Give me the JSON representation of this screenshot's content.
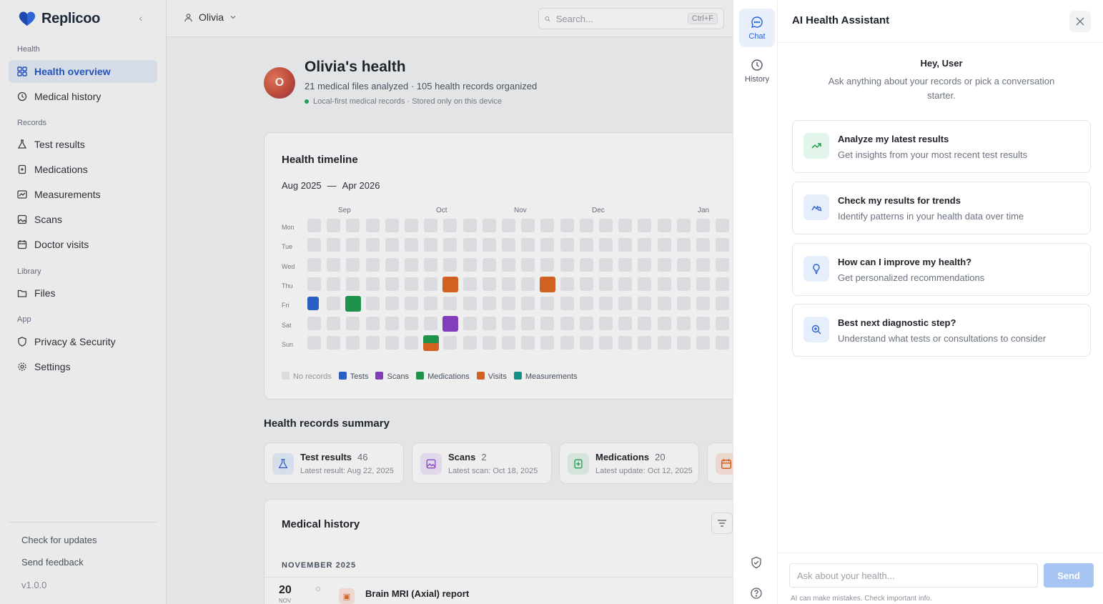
{
  "app": {
    "name": "Replicoo"
  },
  "sidebar": {
    "sections": [
      {
        "label": "Health",
        "items": [
          {
            "label": "Health overview",
            "icon": "grid-icon",
            "active": true
          },
          {
            "label": "Medical history",
            "icon": "clock-icon"
          }
        ]
      },
      {
        "label": "Records",
        "items": [
          {
            "label": "Test results",
            "icon": "flask-icon"
          },
          {
            "label": "Medications",
            "icon": "pill-box-icon"
          },
          {
            "label": "Measurements",
            "icon": "chart-icon"
          },
          {
            "label": "Scans",
            "icon": "image-icon"
          },
          {
            "label": "Doctor visits",
            "icon": "calendar-icon"
          }
        ]
      },
      {
        "label": "Library",
        "items": [
          {
            "label": "Files",
            "icon": "folder-icon"
          }
        ]
      },
      {
        "label": "App",
        "items": [
          {
            "label": "Privacy & Security",
            "icon": "shield-icon"
          },
          {
            "label": "Settings",
            "icon": "gear-icon"
          }
        ]
      }
    ],
    "footer": {
      "check_updates": "Check for updates",
      "send_feedback": "Send feedback",
      "version": "v1.0.0"
    }
  },
  "topbar": {
    "user": "Olivia",
    "search_placeholder": "Search...",
    "shortcut": "Ctrl+F"
  },
  "profile": {
    "initial": "O",
    "title": "Olivia's health",
    "subtitle": "21 medical files analyzed · 105 health records organized",
    "local_note": "Local-first medical records · Stored only on this device"
  },
  "timeline": {
    "title": "Health timeline",
    "range_start": "Aug 2025",
    "range_sep": "—",
    "range_end": "Apr 2026",
    "months": [
      "Sep",
      "Oct",
      "Nov",
      "Dec",
      "Jan"
    ],
    "days": [
      "Mon",
      "Tue",
      "Wed",
      "Thu",
      "Fri",
      "Sat",
      "Sun"
    ],
    "marks": [
      {
        "week": 0,
        "day": 4,
        "type": "Tests"
      },
      {
        "week": 2,
        "day": 4,
        "type": "Medications"
      },
      {
        "week": 7,
        "day": 3,
        "type": "Visits"
      },
      {
        "week": 7,
        "day": 5,
        "type": "Scans"
      },
      {
        "week": 6,
        "day": 6,
        "type": "Medications+Visits"
      },
      {
        "week": 12,
        "day": 3,
        "type": "Visits"
      }
    ],
    "legend": [
      {
        "label": "No records",
        "color": "#e9ebee"
      },
      {
        "label": "Tests",
        "color": "#2b63cf"
      },
      {
        "label": "Scans",
        "color": "#8a3fc8"
      },
      {
        "label": "Medications",
        "color": "#1f9d4f"
      },
      {
        "label": "Visits",
        "color": "#e0661f"
      },
      {
        "label": "Measurements",
        "color": "#139b8c"
      }
    ]
  },
  "summary": {
    "title": "Health records summary",
    "cards": [
      {
        "name": "Test results",
        "count": "46",
        "sub": "Latest result: Aug 22, 2025",
        "icon": "flask-icon",
        "bg": "#e6eefb",
        "fg": "#2b63cf"
      },
      {
        "name": "Scans",
        "count": "2",
        "sub": "Latest scan: Oct 18, 2025",
        "icon": "image-icon",
        "bg": "#f1e8fb",
        "fg": "#8a3fc8"
      },
      {
        "name": "Medications",
        "count": "20",
        "sub": "Latest update: Oct 12, 2025",
        "icon": "pill-box-icon",
        "bg": "#e3f5ea",
        "fg": "#1f9d4f"
      }
    ]
  },
  "medical_history": {
    "title": "Medical history",
    "month": "NOVEMBER 2025",
    "entry": {
      "day": "20",
      "month": "NOV",
      "title": "Brain MRI (Axial) report"
    }
  },
  "rail": {
    "chat": "Chat",
    "history": "History"
  },
  "assistant": {
    "title": "AI Health Assistant",
    "greeting": "Hey, User",
    "greeting_sub": "Ask anything about your records or pick a conversation starter.",
    "starters": [
      {
        "title": "Analyze my latest results",
        "sub": "Get insights from your most recent test results",
        "icon": "trending-up-icon",
        "bg": "#e3f5ea",
        "fg": "#1f9d4f"
      },
      {
        "title": "Check my results for trends",
        "sub": "Identify patterns in your health data over time",
        "icon": "trend-analysis-icon",
        "bg": "#e6eefb",
        "fg": "#2b63cf"
      },
      {
        "title": "How can I improve my health?",
        "sub": "Get personalized recommendations",
        "icon": "lightbulb-icon",
        "bg": "#e6eefb",
        "fg": "#2b63cf"
      },
      {
        "title": "Best next diagnostic step?",
        "sub": "Understand what tests or consultations to consider",
        "icon": "search-plus-icon",
        "bg": "#e6eefb",
        "fg": "#2b63cf"
      }
    ],
    "input_placeholder": "Ask about your health...",
    "send": "Send",
    "disclaimer": "AI can make mistakes. Check important info."
  }
}
